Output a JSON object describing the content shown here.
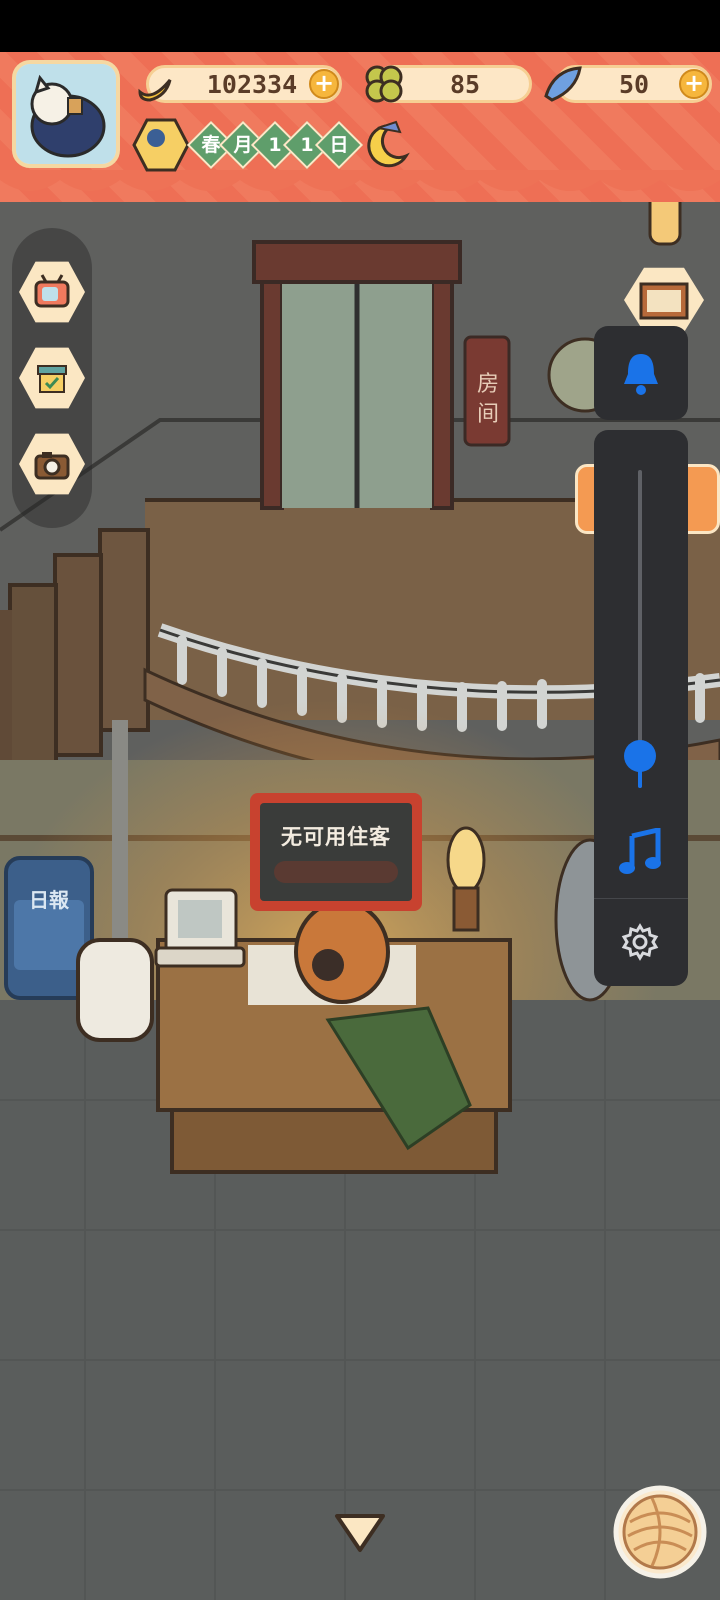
{
  "currencies": {
    "banana": {
      "icon": "banana-icon",
      "value": "102334"
    },
    "clover": {
      "icon": "clover-icon",
      "value": "85"
    },
    "fish": {
      "icon": "fish-icon",
      "value": "50"
    }
  },
  "calendar": {
    "chars": [
      "春",
      "月",
      "1",
      "1",
      "日"
    ]
  },
  "building": {
    "room_sign_chars": [
      "房",
      "间"
    ],
    "daily_sign": "日報"
  },
  "reception": {
    "notice_text": "无可用住客"
  },
  "volume_panel": {
    "level": 0.1
  },
  "colors": {
    "banner": "#ef7459",
    "cream": "#fde7c6",
    "accent_blue": "#1a73e8",
    "panel_dark": "#2d2e31"
  }
}
